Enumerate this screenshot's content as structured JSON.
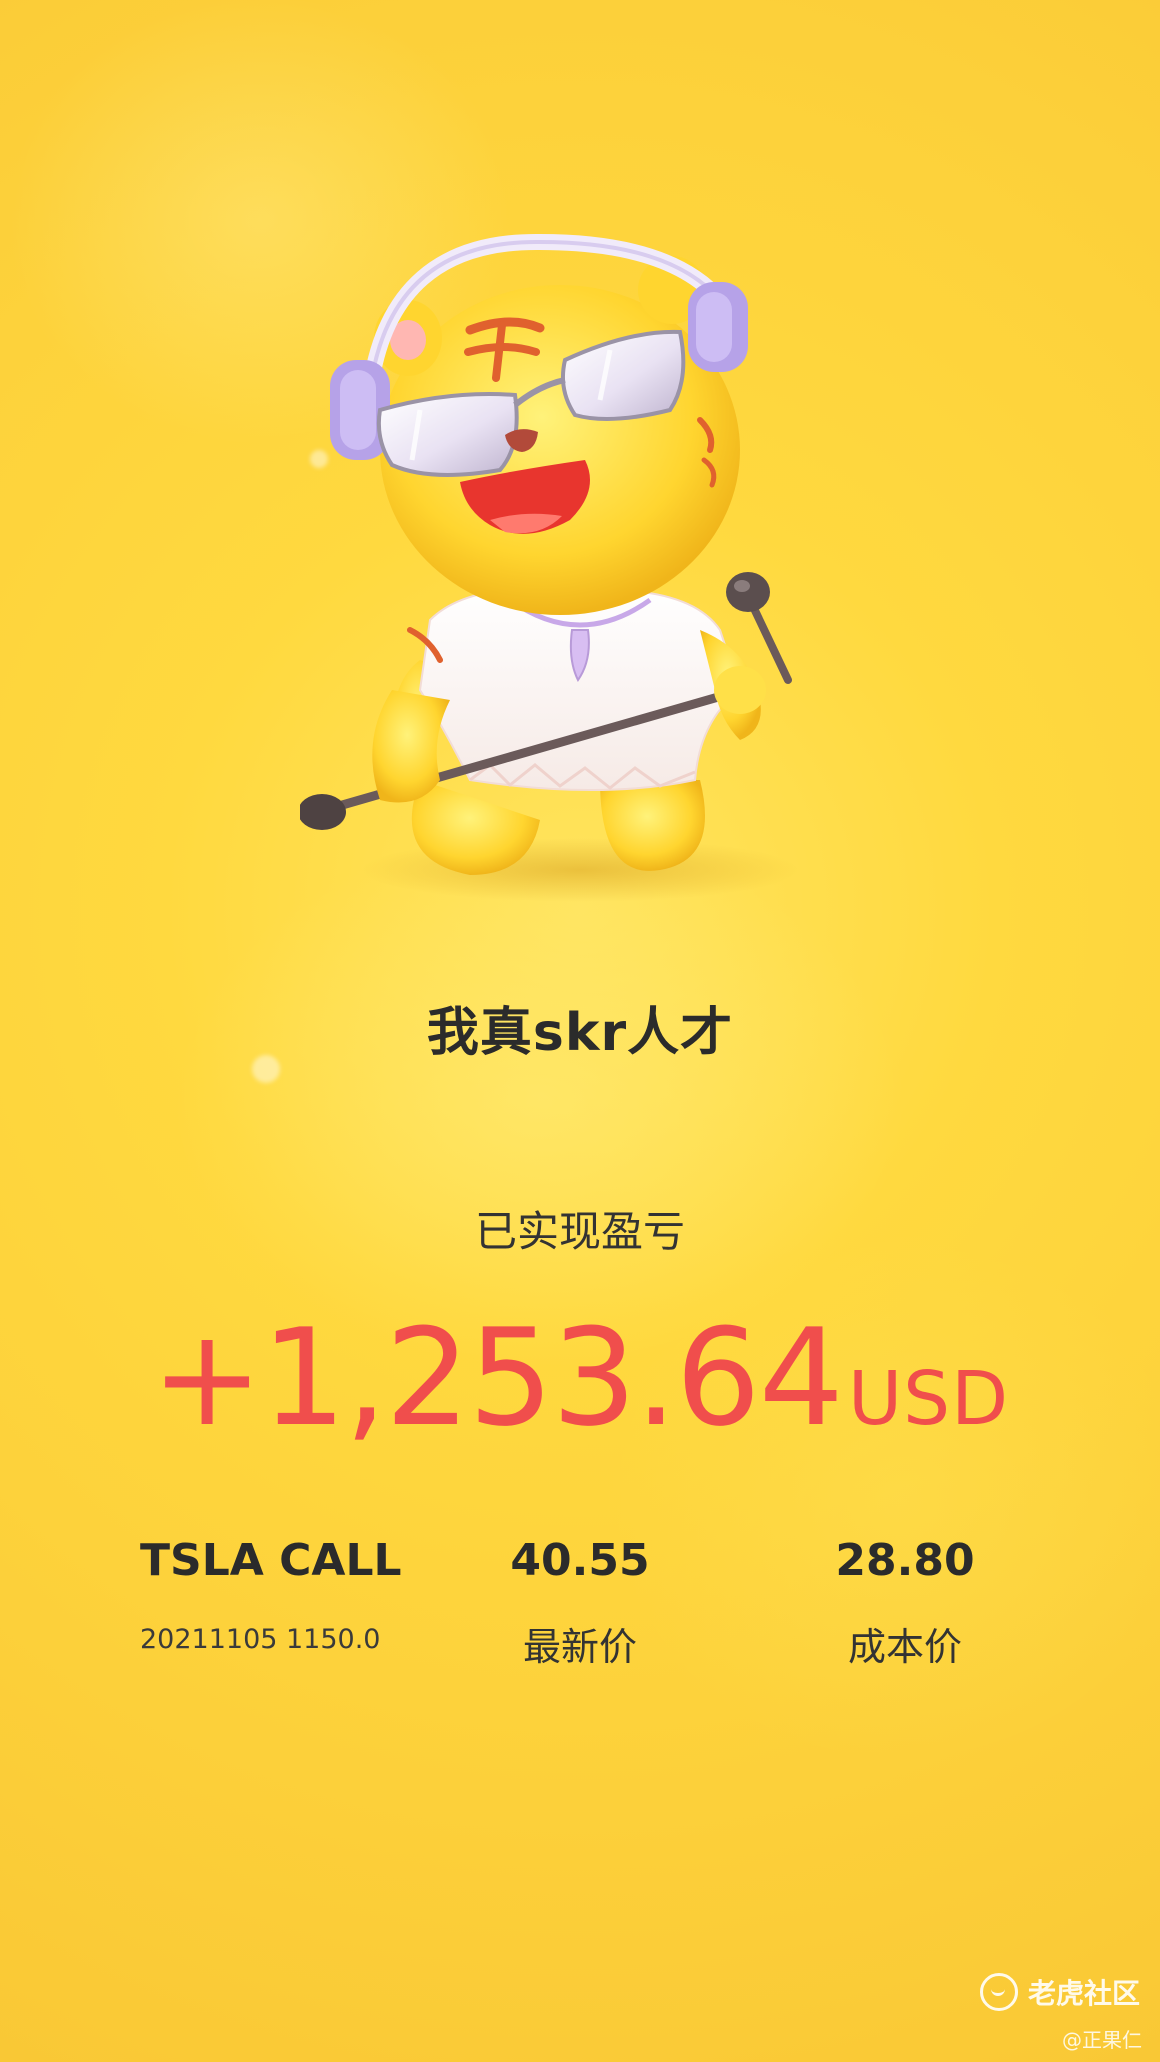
{
  "card": {
    "title": "我真skr人才",
    "pnl_label": "已实现盈亏",
    "pnl_value": "+1,253.64",
    "pnl_currency": "USD"
  },
  "position": {
    "symbol": "TSLA CALL",
    "contract": "20211105 1150.0",
    "last_price": "40.55",
    "last_price_label": "最新价",
    "cost_price": "28.80",
    "cost_price_label": "成本价"
  },
  "watermark": {
    "brand": "老虎社区",
    "user": "@正果仁"
  },
  "colors": {
    "background": "#FDD23B",
    "profit": "#F04E4C",
    "text": "#2B2B2B"
  },
  "icons": {
    "mascot": "tiger-mascot-with-headphones-and-microphone",
    "watermark": "tiger-community-logo-icon"
  }
}
